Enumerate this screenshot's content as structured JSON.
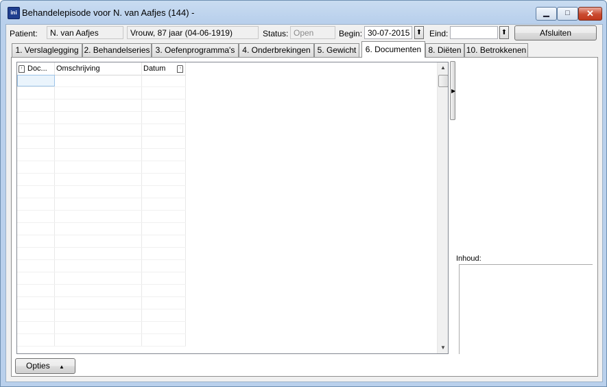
{
  "window": {
    "title": "Behandelepisode voor N. van Aafjes (144) -",
    "app_icon_text": "ini",
    "controls": {
      "minimize": "▁",
      "maximize": "□",
      "close": "✕"
    }
  },
  "header": {
    "patient_label": "Patient:",
    "patient_name": "N. van Aafjes",
    "patient_info": "Vrouw, 87 jaar (04-06-1919)",
    "status_label": "Status:",
    "status_value": "Open",
    "begin_label": "Begin:",
    "begin_value": "30-07-2015",
    "eind_label": "Eind:",
    "eind_value": "",
    "spin_icon": "⬆",
    "close_button": "Afsluiten"
  },
  "tabs": [
    {
      "label": "1. Verslaglegging"
    },
    {
      "label": "2. Behandelseries"
    },
    {
      "label": "3. Oefenprogramma's"
    },
    {
      "label": "4. Onderbrekingen"
    },
    {
      "label": "5. Gewicht"
    },
    {
      "label": "6. Documenten"
    },
    {
      "label": "8. Diëten"
    },
    {
      "label": "10. Betrokkenen"
    }
  ],
  "active_tab": "6. Documenten",
  "grid": {
    "columns": [
      {
        "label": "Doc..."
      },
      {
        "label": "Omschrijving"
      },
      {
        "label": "Datum"
      }
    ],
    "rows": []
  },
  "inhoud_label": "Inhoud:",
  "options_button": "Opties",
  "options_arrow": "▲",
  "scroll_up": "▲",
  "scroll_down": "▼",
  "splitter_arrow": "▶"
}
